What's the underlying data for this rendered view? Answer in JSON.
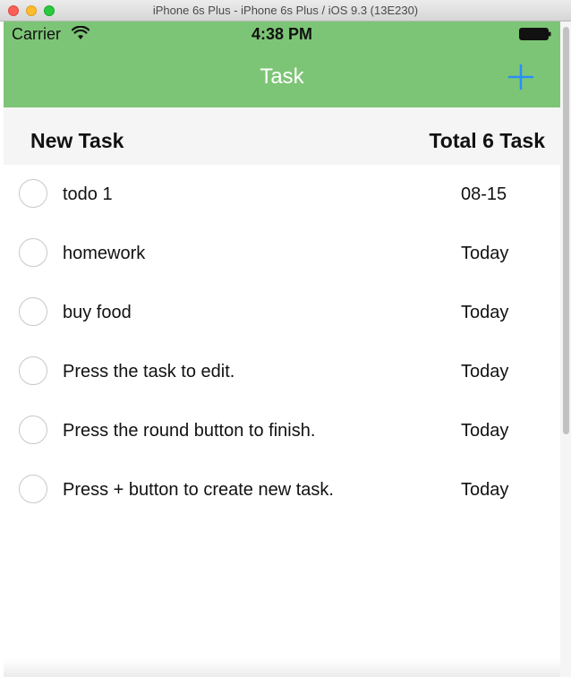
{
  "window": {
    "title": "iPhone 6s Plus - iPhone 6s Plus / iOS 9.3 (13E230)"
  },
  "status_bar": {
    "carrier": "Carrier",
    "time": "4:38 PM"
  },
  "navbar": {
    "title": "Task",
    "add_icon": "plus-icon",
    "color": "#7dc576",
    "add_color": "#2a8ff7"
  },
  "header": {
    "left": "New Task",
    "right": "Total 6 Task"
  },
  "tasks": [
    {
      "title": "todo 1",
      "date": "08-15",
      "done": false
    },
    {
      "title": "homework",
      "date": "Today",
      "done": false
    },
    {
      "title": "buy food",
      "date": "Today",
      "done": false
    },
    {
      "title": "Press the task to edit.",
      "date": "Today",
      "done": false
    },
    {
      "title": "Press the round button to finish.",
      "date": "Today",
      "done": false
    },
    {
      "title": "Press + button to create new task.",
      "date": "Today",
      "done": false
    }
  ]
}
